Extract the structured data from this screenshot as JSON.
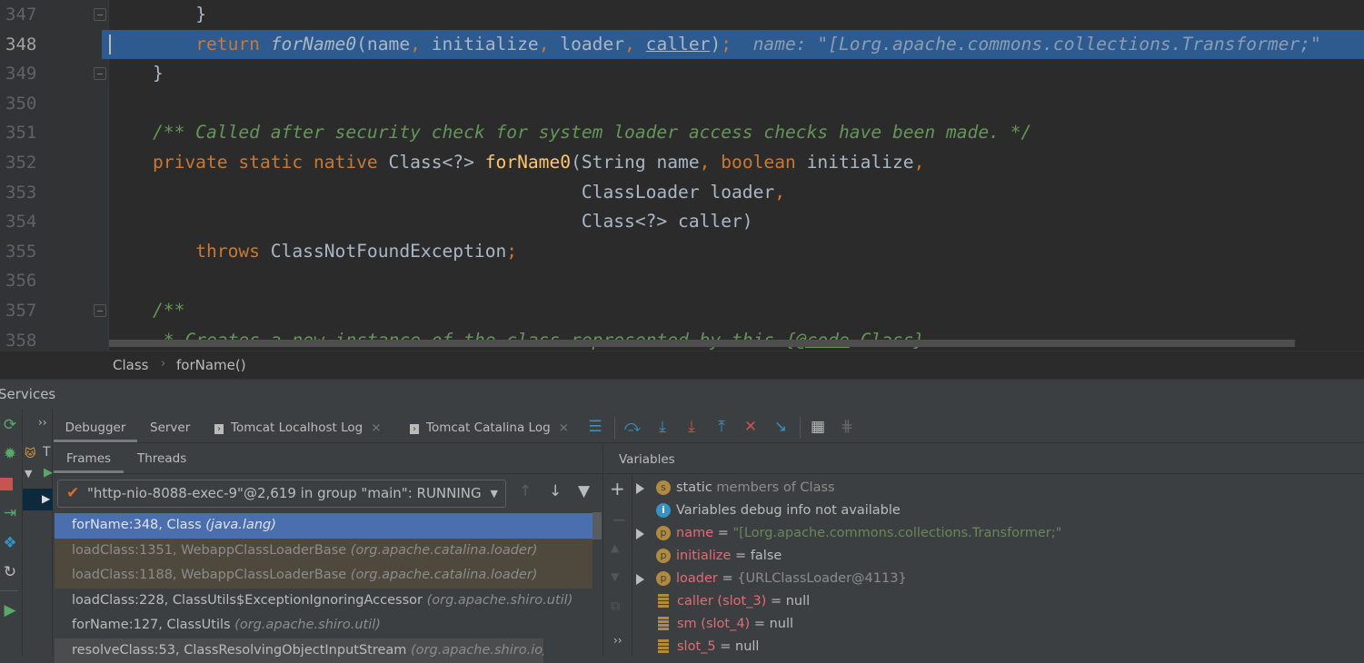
{
  "editor": {
    "current_line": 348,
    "lines": [
      {
        "num": "347",
        "indent": "    ",
        "fold": true,
        "tokens": [
          {
            "t": "}",
            "k": "pl"
          }
        ]
      },
      {
        "num": "348",
        "indent": "    ",
        "current": true,
        "tokens": [
          {
            "t": "return ",
            "k": "kw"
          },
          {
            "t": "forName0",
            "k": "pl it"
          },
          {
            "t": "(name",
            "k": "pl"
          },
          {
            "t": ", ",
            "k": "kw"
          },
          {
            "t": "initialize",
            "k": "pl"
          },
          {
            "t": ", ",
            "k": "kw"
          },
          {
            "t": "loader",
            "k": "pl"
          },
          {
            "t": ", ",
            "k": "kw"
          },
          {
            "t": "caller",
            "k": "pl ul"
          },
          {
            "t": ")",
            "k": "pl"
          },
          {
            "t": ";",
            "k": "kw"
          },
          {
            "t": "  name: \"[Lorg.apache.commons.collections.Transformer;\"",
            "k": "hint"
          }
        ]
      },
      {
        "num": "349",
        "indent": "",
        "fold": true,
        "tokens": [
          {
            "t": "}",
            "k": "pl"
          }
        ]
      },
      {
        "num": "350",
        "indent": "",
        "tokens": []
      },
      {
        "num": "351",
        "indent": "",
        "tokens": [
          {
            "t": "/** Called after security check for system loader access checks have been made. */",
            "k": "cm"
          }
        ]
      },
      {
        "num": "352",
        "indent": "",
        "tokens": [
          {
            "t": "private static native ",
            "k": "kw"
          },
          {
            "t": "Class<?> ",
            "k": "pl"
          },
          {
            "t": "forName0",
            "k": "fn"
          },
          {
            "t": "(String name",
            "k": "pl"
          },
          {
            "t": ", ",
            "k": "kw"
          },
          {
            "t": "boolean ",
            "k": "kw"
          },
          {
            "t": "initialize",
            "k": "pl"
          },
          {
            "t": ",",
            "k": "kw"
          }
        ]
      },
      {
        "num": "353",
        "indent": "                                        ",
        "tokens": [
          {
            "t": "ClassLoader loader",
            "k": "pl"
          },
          {
            "t": ",",
            "k": "kw"
          }
        ]
      },
      {
        "num": "354",
        "indent": "                                        ",
        "tokens": [
          {
            "t": "Class<?> caller)",
            "k": "pl"
          }
        ]
      },
      {
        "num": "355",
        "indent": "    ",
        "tokens": [
          {
            "t": "throws ",
            "k": "kw"
          },
          {
            "t": "ClassNotFoundException",
            "k": "pl"
          },
          {
            "t": ";",
            "k": "kw"
          }
        ]
      },
      {
        "num": "356",
        "indent": "",
        "tokens": []
      },
      {
        "num": "357",
        "indent": "",
        "fold": true,
        "tokens": [
          {
            "t": "/**",
            "k": "cm"
          }
        ]
      },
      {
        "num": "358",
        "indent": " ",
        "tokens": [
          {
            "t": "* Creates a new instance of the class represented by this {",
            "k": "cm"
          },
          {
            "t": "@code",
            "k": "cmtag"
          },
          {
            "t": " Class}",
            "k": "cm"
          }
        ]
      }
    ]
  },
  "breadcrumb": {
    "items": [
      "Class",
      "forName()"
    ],
    "separator": "›"
  },
  "services": {
    "title": "Services"
  },
  "tabs": {
    "expand": "››",
    "items": [
      {
        "label": "Debugger",
        "active": true
      },
      {
        "label": "Server"
      },
      {
        "label": "Tomcat Localhost Log",
        "closable": true
      },
      {
        "label": "Tomcat Catalina Log",
        "closable": true
      }
    ],
    "close": "×"
  },
  "subtabs": {
    "frames": "Frames",
    "threads": "Threads",
    "variables": "Variables"
  },
  "tree": {
    "node": "T"
  },
  "thread": {
    "selected": "\"http-nio-8088-exec-9\"@2,619 in group \"main\": RUNNING"
  },
  "frames": [
    {
      "method": "forName:348, Class",
      "pkg": "(java.lang)",
      "state": "selected"
    },
    {
      "method": "loadClass:1351, WebappClassLoaderBase",
      "pkg": "(org.apache.catalina.loader)",
      "state": "library"
    },
    {
      "method": "loadClass:1188, WebappClassLoaderBase",
      "pkg": "(org.apache.catalina.loader)",
      "state": "library"
    },
    {
      "method": "loadClass:228, ClassUtils$ExceptionIgnoringAccessor",
      "pkg": "(org.apache.shiro.util)",
      "state": "normal"
    },
    {
      "method": "forName:127, ClassUtils",
      "pkg": "(org.apache.shiro.util)",
      "state": "normal"
    },
    {
      "method": "resolveClass:53, ClassResolvingObjectInputStream",
      "pkg": "(org.apache.shiro.io)",
      "state": "partial"
    }
  ],
  "variables": [
    {
      "icon": "s",
      "expandable": true,
      "name": "static",
      "rest": " members of Class",
      "kind": "static"
    },
    {
      "icon": "i",
      "text": "Variables debug info not available",
      "kind": "info"
    },
    {
      "icon": "p",
      "expandable": true,
      "name": "name",
      "eq": " = ",
      "value": "\"[Lorg.apache.commons.collections.Transformer;\"",
      "kind": "str"
    },
    {
      "icon": "p",
      "name": "initialize",
      "eq": " = ",
      "value": "false",
      "kind": "plain"
    },
    {
      "icon": "p",
      "expandable": true,
      "name": "loader",
      "eq": " = ",
      "value": "{URLClassLoader@4113}",
      "kind": "gray"
    },
    {
      "icon": "f",
      "name": "caller (slot_3)",
      "eq": " = ",
      "value": "null",
      "kind": "plain"
    },
    {
      "icon": "f",
      "name": "sm (slot_4)",
      "eq": " = ",
      "value": "null",
      "kind": "plain"
    },
    {
      "icon": "f",
      "name": "slot_5",
      "eq": " = ",
      "value": "null",
      "kind": "plain"
    }
  ],
  "colors": {
    "selection": "#4b6eaf",
    "library_frame": "#4e493c",
    "current_line": "#2d5a8f",
    "var_name": "#e06c75",
    "string": "#6a8759"
  }
}
